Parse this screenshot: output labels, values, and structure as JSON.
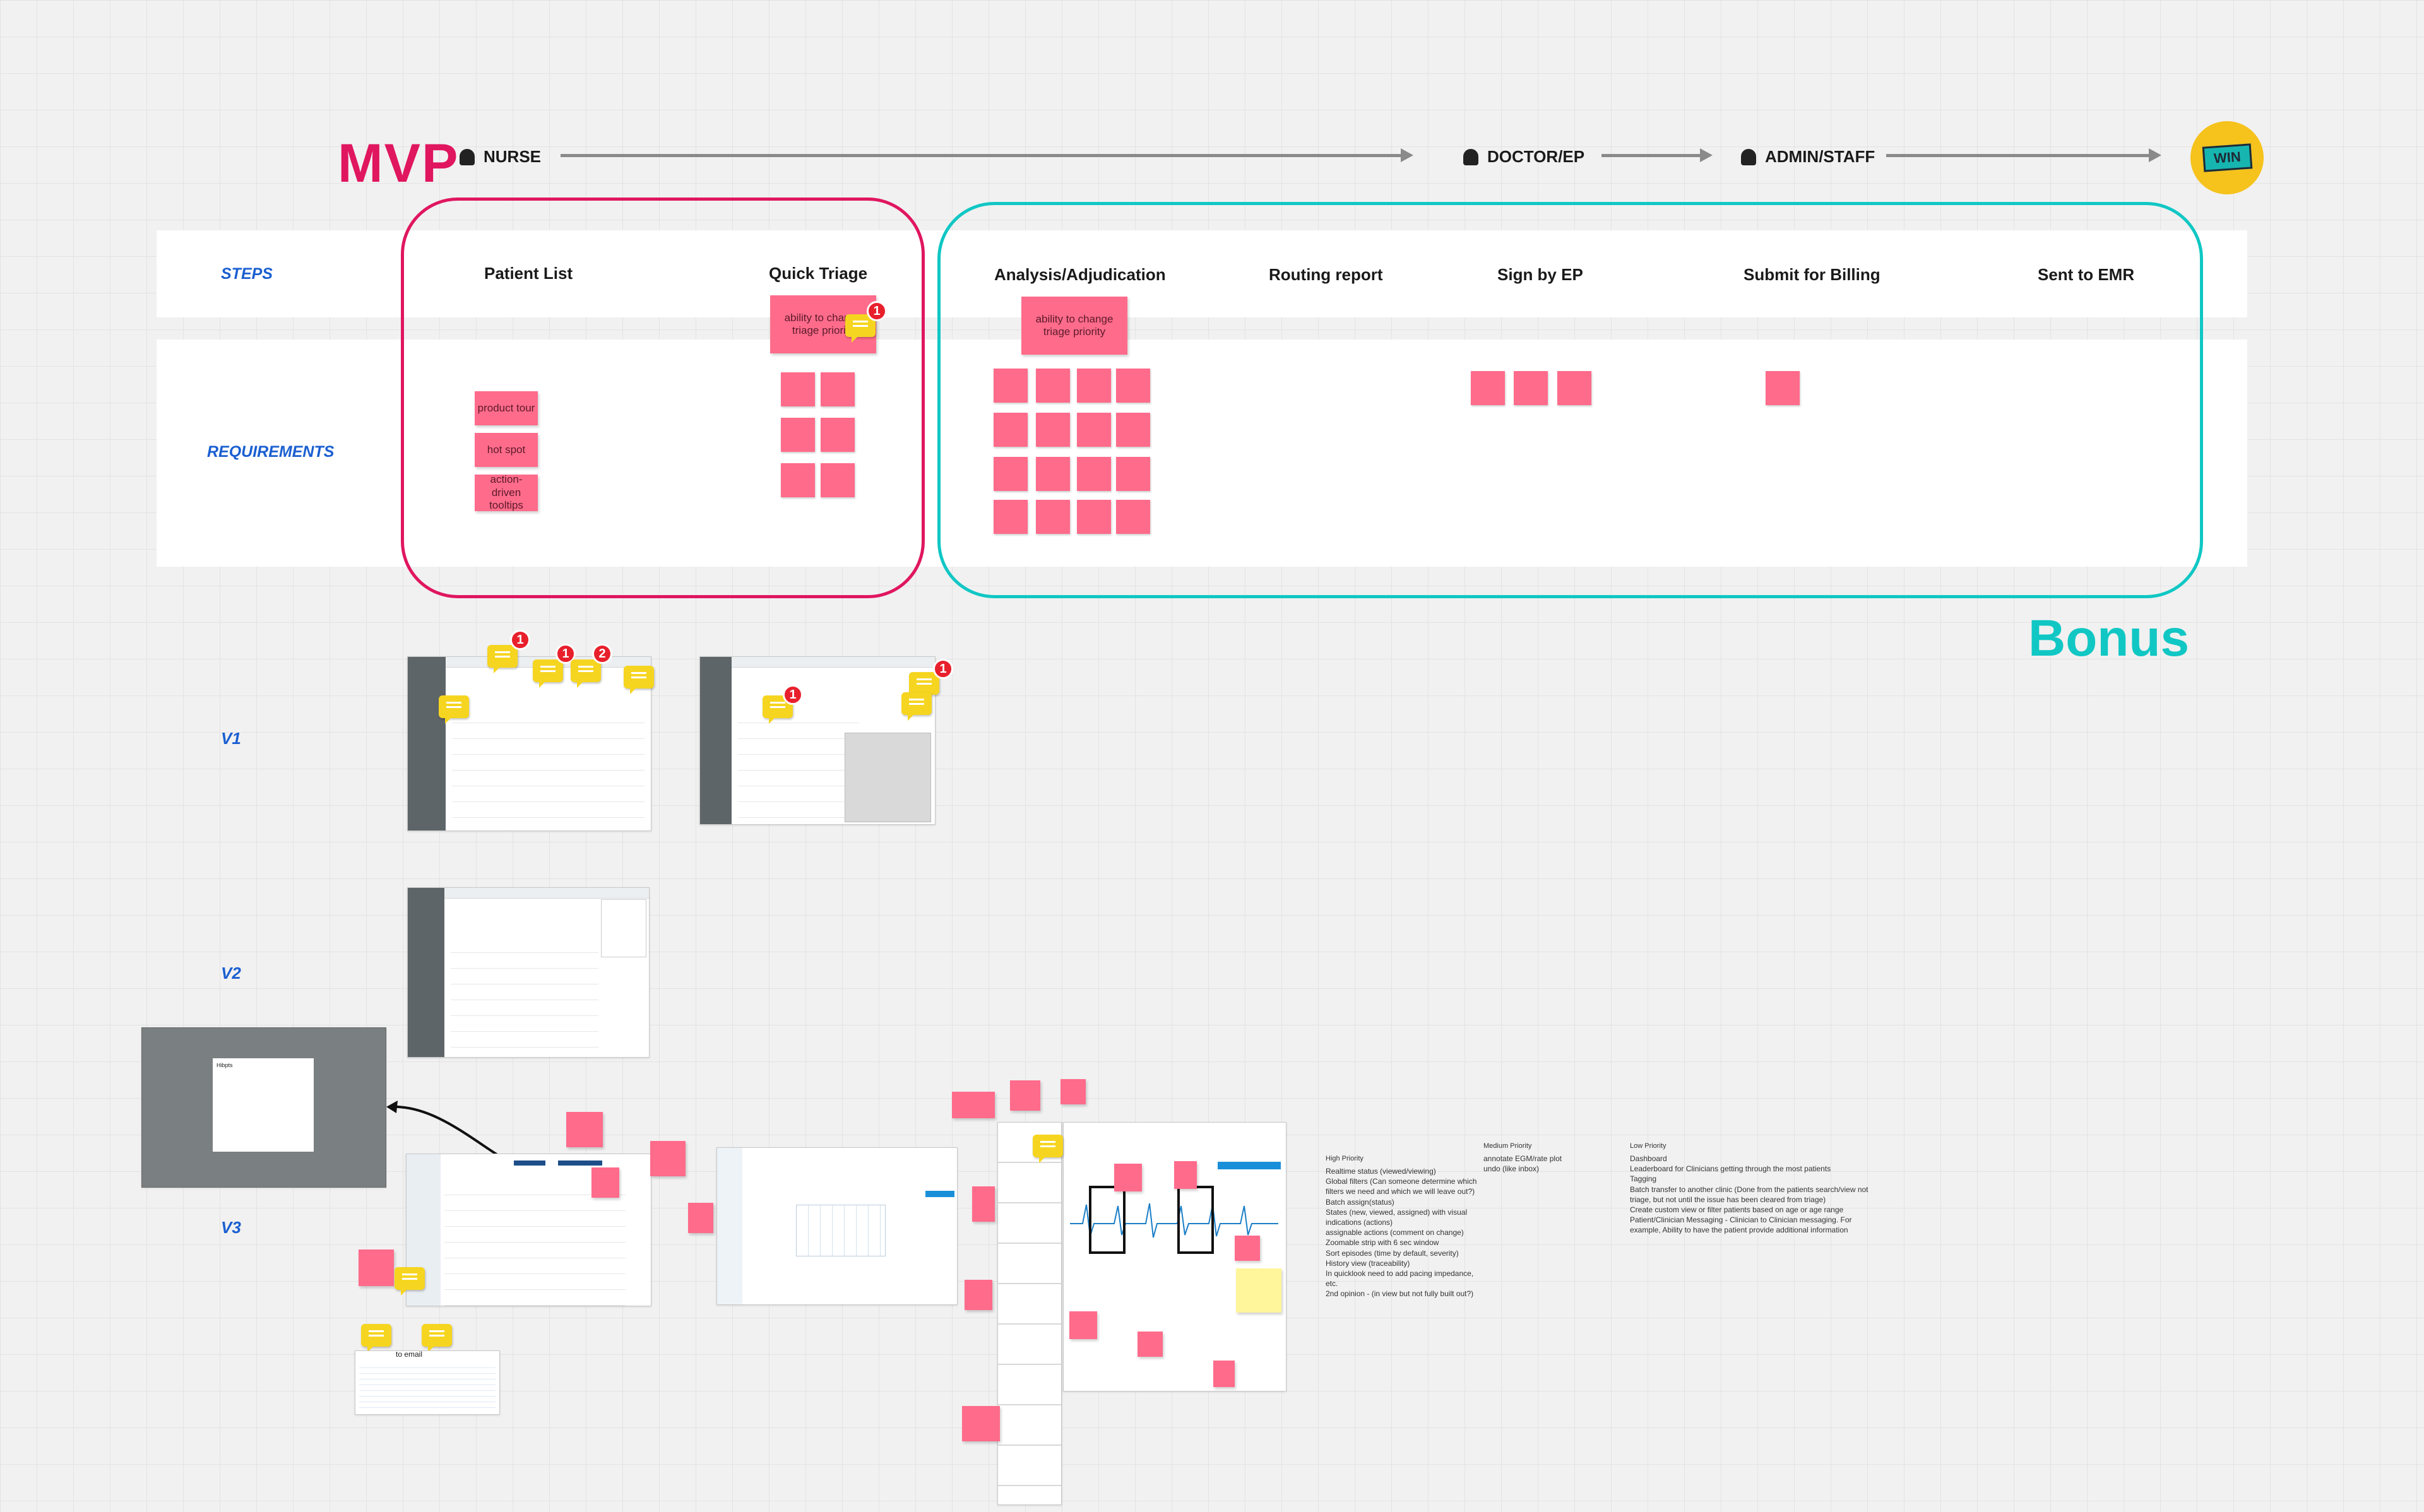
{
  "header": {
    "mvp_label": "MVP",
    "bonus_label": "Bonus",
    "roles": [
      "NURSE",
      "DOCTOR/EP",
      "ADMIN/STAFF"
    ],
    "win_label": "WIN"
  },
  "rows": {
    "steps_label": "STEPS",
    "requirements_label": "REQUIREMENTS"
  },
  "steps": [
    "Patient List",
    "Quick Triage",
    "Analysis/Adjudication",
    "Routing report",
    "Sign by EP",
    "Submit for Billing",
    "Sent to EMR"
  ],
  "stickies": {
    "quick_triage_note": "ability to change triage priority",
    "analysis_note": "ability to change triage priority",
    "patient_list_reqs": [
      "product tour",
      "hot spot",
      "action-driven tooltips"
    ]
  },
  "comment_counts": {
    "quick_triage": "1",
    "v1_a": "1",
    "v1_b": "1",
    "v1_c": "2",
    "v1_d": "1",
    "v1_e": "1"
  },
  "versions": [
    "V1",
    "V2",
    "V3"
  ],
  "v3": {
    "popup_title": "Hibpts",
    "modal_action": "to email"
  },
  "priority_notes": {
    "high_title": "High Priority",
    "high_items": [
      "Realtime status (viewed/viewing)",
      "Global filters (Can someone determine which filters we need and which we will leave out?)",
      "Batch assign(status)",
      "States (new, viewed, assigned) with visual indications (actions)",
      "assignable actions (comment on change)",
      "Zoomable strip with 6 sec window",
      "Sort episodes (time by default, severity)",
      "History view (traceability)",
      "In quicklook need to add pacing impedance, etc.",
      "2nd opinion - (in view but not fully built out?)"
    ],
    "medium_title": "Medium Priority",
    "medium_items": [
      "annotate EGM/rate plot",
      "undo (like inbox)"
    ],
    "low_title": "Low Priority",
    "low_items": [
      "Dashboard",
      "Leaderboard for Clinicians getting through the most patients",
      "Tagging",
      "Batch transfer to another clinic (Done from the patients search/view not triage, but not until the issue has been cleared from triage)",
      "Create custom view or filter patients based on age or age range",
      "Patient/Clinician Messaging - Clinician to Clinician messaging. For example, Ability to have the patient provide additional information"
    ]
  },
  "colors": {
    "mvp": "#e0165f",
    "bonus": "#10c7c4",
    "sticky": "#ff6b8b",
    "comment": "#f6d520",
    "label": "#1a5fd1"
  }
}
